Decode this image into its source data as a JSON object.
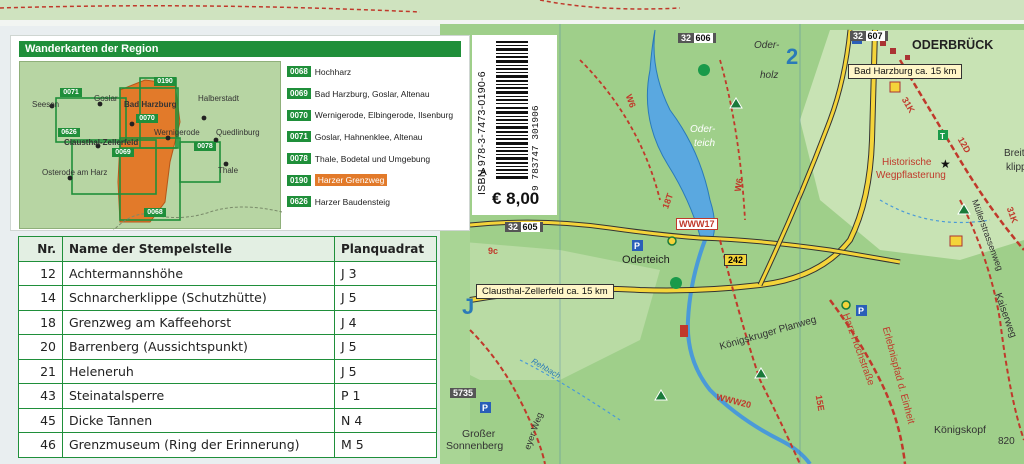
{
  "region_panel": {
    "title": "Wanderkarten der Region",
    "map_labels": {
      "seesen": "Seesen",
      "goslar": "Goslar",
      "bad_harzburg": "Bad Harzburg",
      "halberstadt": "Halberstadt",
      "wernigerode": "Wernigerode",
      "quedlinburg": "Quedlinburg",
      "clausthal": "Clausthal-Zellerfeld",
      "thale": "Thale",
      "osterode": "Osterode am Harz"
    },
    "map_codes": {
      "c0190": "0190",
      "c0071": "0071",
      "c0070": "0070",
      "c0626": "0626",
      "c0069": "0069",
      "c0078": "0078",
      "c0068": "0068"
    },
    "legend": [
      {
        "code": "0068",
        "label": "Hochharz",
        "highlight": false
      },
      {
        "code": "0069",
        "label": "Bad Harzburg, Goslar, Altenau",
        "highlight": false
      },
      {
        "code": "0070",
        "label": "Wernigerode, Elbingerode, Ilsenburg",
        "highlight": false
      },
      {
        "code": "0071",
        "label": "Goslar, Hahnenklee, Altenau",
        "highlight": false
      },
      {
        "code": "0078",
        "label": "Thale, Bodetal und Umgebung",
        "highlight": false
      },
      {
        "code": "0190",
        "label": "Harzer Grenzweg",
        "highlight": true
      },
      {
        "code": "0626",
        "label": "Harzer Baudensteig",
        "highlight": false
      }
    ]
  },
  "isbn": {
    "text": "ISBN 978-3-7473-0190-6",
    "barcode_digits": "9 783747 301906",
    "side_letter": "A",
    "price": "€ 8,00"
  },
  "stamp_table": {
    "headers": {
      "nr": "Nr.",
      "name": "Name der Stempelstelle",
      "grid": "Planquadrat"
    },
    "rows": [
      {
        "nr": "12",
        "name": "Achtermannshöhe",
        "grid": "J 3"
      },
      {
        "nr": "14",
        "name": "Schnarcherklippe (Schutzhütte)",
        "grid": "J 5"
      },
      {
        "nr": "18",
        "name": "Grenzweg am Kaffeehorst",
        "grid": "J 4"
      },
      {
        "nr": "20",
        "name": "Barrenberg (Aussichtspunkt)",
        "grid": "J 5"
      },
      {
        "nr": "21",
        "name": "Heleneruh",
        "grid": "J 5"
      },
      {
        "nr": "43",
        "name": "Steinatalsperre",
        "grid": "P 1"
      },
      {
        "nr": "45",
        "name": "Dicke Tannen",
        "grid": "N 4"
      },
      {
        "nr": "46",
        "name": "Grenzmuseum (Ring der Erinnerung)",
        "grid": "M 5"
      }
    ]
  },
  "map": {
    "grid_2": "2",
    "grid_j": "J",
    "oderbrueck": "ODERBRÜCK",
    "road_32_606": "32",
    "road_32_606_b": "606",
    "road_32_607": "32",
    "road_32_607_b": "607",
    "road_32_605": "32",
    "road_32_605_b": "605",
    "road_242": "242",
    "sign_bad_harzburg": "Bad Harzburg ca. 15 km",
    "sign_clausthal": "Clausthal-Zellerfeld ca. 15 km",
    "oder_holz_1": "Oder-",
    "oder_holz_2": "holz",
    "oderteich_lake_1": "Oder-",
    "oderteich_lake_2": "teich",
    "oderteich": "Oderteich",
    "historische_1": "Historische",
    "historische_2": "Wegpflasterung",
    "breite_1": "Breite",
    "breite_2": "klipp",
    "koenigskruger": "Königskruger Planweg",
    "harz_hochstrasse": "Harz-Hochstraße",
    "erdbeerweg": "Erlebnispfad d. Einheit",
    "kaiserweg": "Kaiserweg",
    "koenigskopf": "Königskopf",
    "grosser_1": "Großer",
    "grosser_2": "Sonnenberg",
    "elev_5735": "5735",
    "elev_820": "820",
    "meyer_weg": "eyer-Weg",
    "www17": "WWW17",
    "www20": "WWW20",
    "trail_w6": "W6",
    "trail_w6b": "W6",
    "trail_31k": "31K",
    "trail_12d": "12D",
    "trail_31k_b": "31K",
    "trail_15e": "15E",
    "trail_9c": "9c",
    "trail_18t": "18T",
    "muehlenwinkel": "Müllerstrassenweg",
    "rehbach": "Rehbach"
  }
}
